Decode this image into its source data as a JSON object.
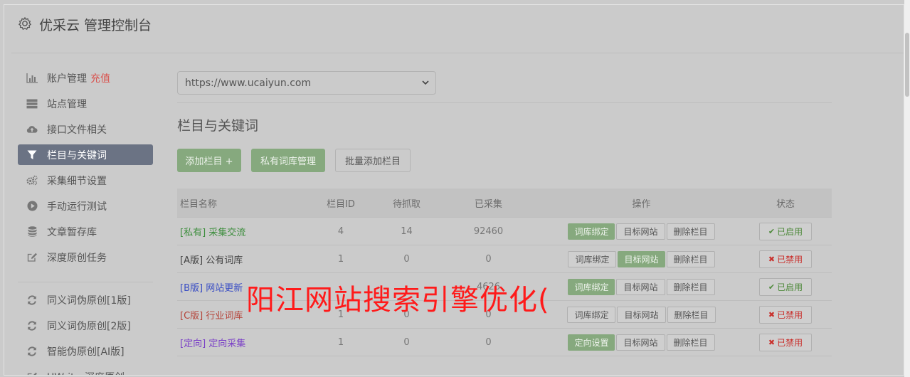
{
  "header": {
    "title": "优采云 管理控制台",
    "icon": "gear-icon"
  },
  "sidebar": {
    "items": [
      {
        "label": "账户管理",
        "extra": "充值",
        "icon": "bar-chart-icon"
      },
      {
        "label": "站点管理",
        "icon": "server-icon"
      },
      {
        "label": "接口文件相关",
        "icon": "cloud-upload-icon"
      },
      {
        "label": "栏目与关键词",
        "icon": "filter-icon",
        "active": true
      },
      {
        "label": "采集细节设置",
        "icon": "gears-icon"
      },
      {
        "label": "手动运行测试",
        "icon": "play-circle-icon"
      },
      {
        "label": "文章暂存库",
        "icon": "database-icon"
      },
      {
        "label": "深度原创任务",
        "icon": "edit-icon"
      }
    ],
    "items2": [
      {
        "label": "同义词伪原创[1版]",
        "icon": "refresh-icon"
      },
      {
        "label": "同义词伪原创[2版]",
        "icon": "refresh-icon"
      },
      {
        "label": "智能伪原创[AI版]",
        "icon": "refresh-icon"
      },
      {
        "label": "UWriter深度原创",
        "icon": "edit-icon"
      }
    ]
  },
  "site_select": {
    "value": "https://www.ucaiyun.com"
  },
  "section": {
    "title": "栏目与关键词"
  },
  "buttons": {
    "add": "添加栏目 +",
    "private": "私有词库管理",
    "batch": "批量添加栏目"
  },
  "table": {
    "headers": [
      "栏目名称",
      "栏目ID",
      "待抓取",
      "已采集",
      "操作",
      "状态"
    ],
    "rows": [
      {
        "tag": "[私有]",
        "name": "采集交流",
        "color": "#3e8e3e",
        "id": "4",
        "pending": "14",
        "collected": "92460",
        "op1": "词库绑定",
        "op1_green": true,
        "op2": "目标网站",
        "op2_green": false,
        "op3": "删除栏目",
        "status": "已启用",
        "enabled": true
      },
      {
        "tag": "[A版]",
        "name": "公有词库",
        "color": "#444444",
        "id": "1",
        "pending": "0",
        "collected": "0",
        "op1": "词库绑定",
        "op1_green": false,
        "op2": "目标网站",
        "op2_green": true,
        "op3": "删除栏目",
        "status": "已禁用",
        "enabled": false
      },
      {
        "tag": "[B版]",
        "name": "网站更新",
        "color": "#3b4fc4",
        "id": "",
        "pending": "",
        "collected": "4626",
        "op1": "词库绑定",
        "op1_green": true,
        "op2": "目标网站",
        "op2_green": false,
        "op3": "删除栏目",
        "status": "已启用",
        "enabled": true
      },
      {
        "tag": "[C版]",
        "name": "行业词库",
        "color": "#b5443a",
        "id": "1",
        "pending": "0",
        "collected": "0",
        "op1": "词库绑定",
        "op1_green": false,
        "op2": "目标网站",
        "op2_green": false,
        "op3": "删除栏目",
        "status": "已禁用",
        "enabled": false
      },
      {
        "tag": "[定向]",
        "name": "定向采集",
        "color": "#7a3fc7",
        "id": "1",
        "pending": "0",
        "collected": "0",
        "op1": "定向设置",
        "op1_green": true,
        "op2": "目标网站",
        "op2_green": false,
        "op3": "删除栏目",
        "status": "已禁用",
        "enabled": false
      }
    ]
  },
  "overlay": {
    "text": "阳江网站搜索引擎优化("
  },
  "colors": {
    "accent_green": "#86a97e",
    "active_nav": "#6b7384",
    "danger": "#d9534f",
    "link_blue": "#4d7aa8"
  }
}
